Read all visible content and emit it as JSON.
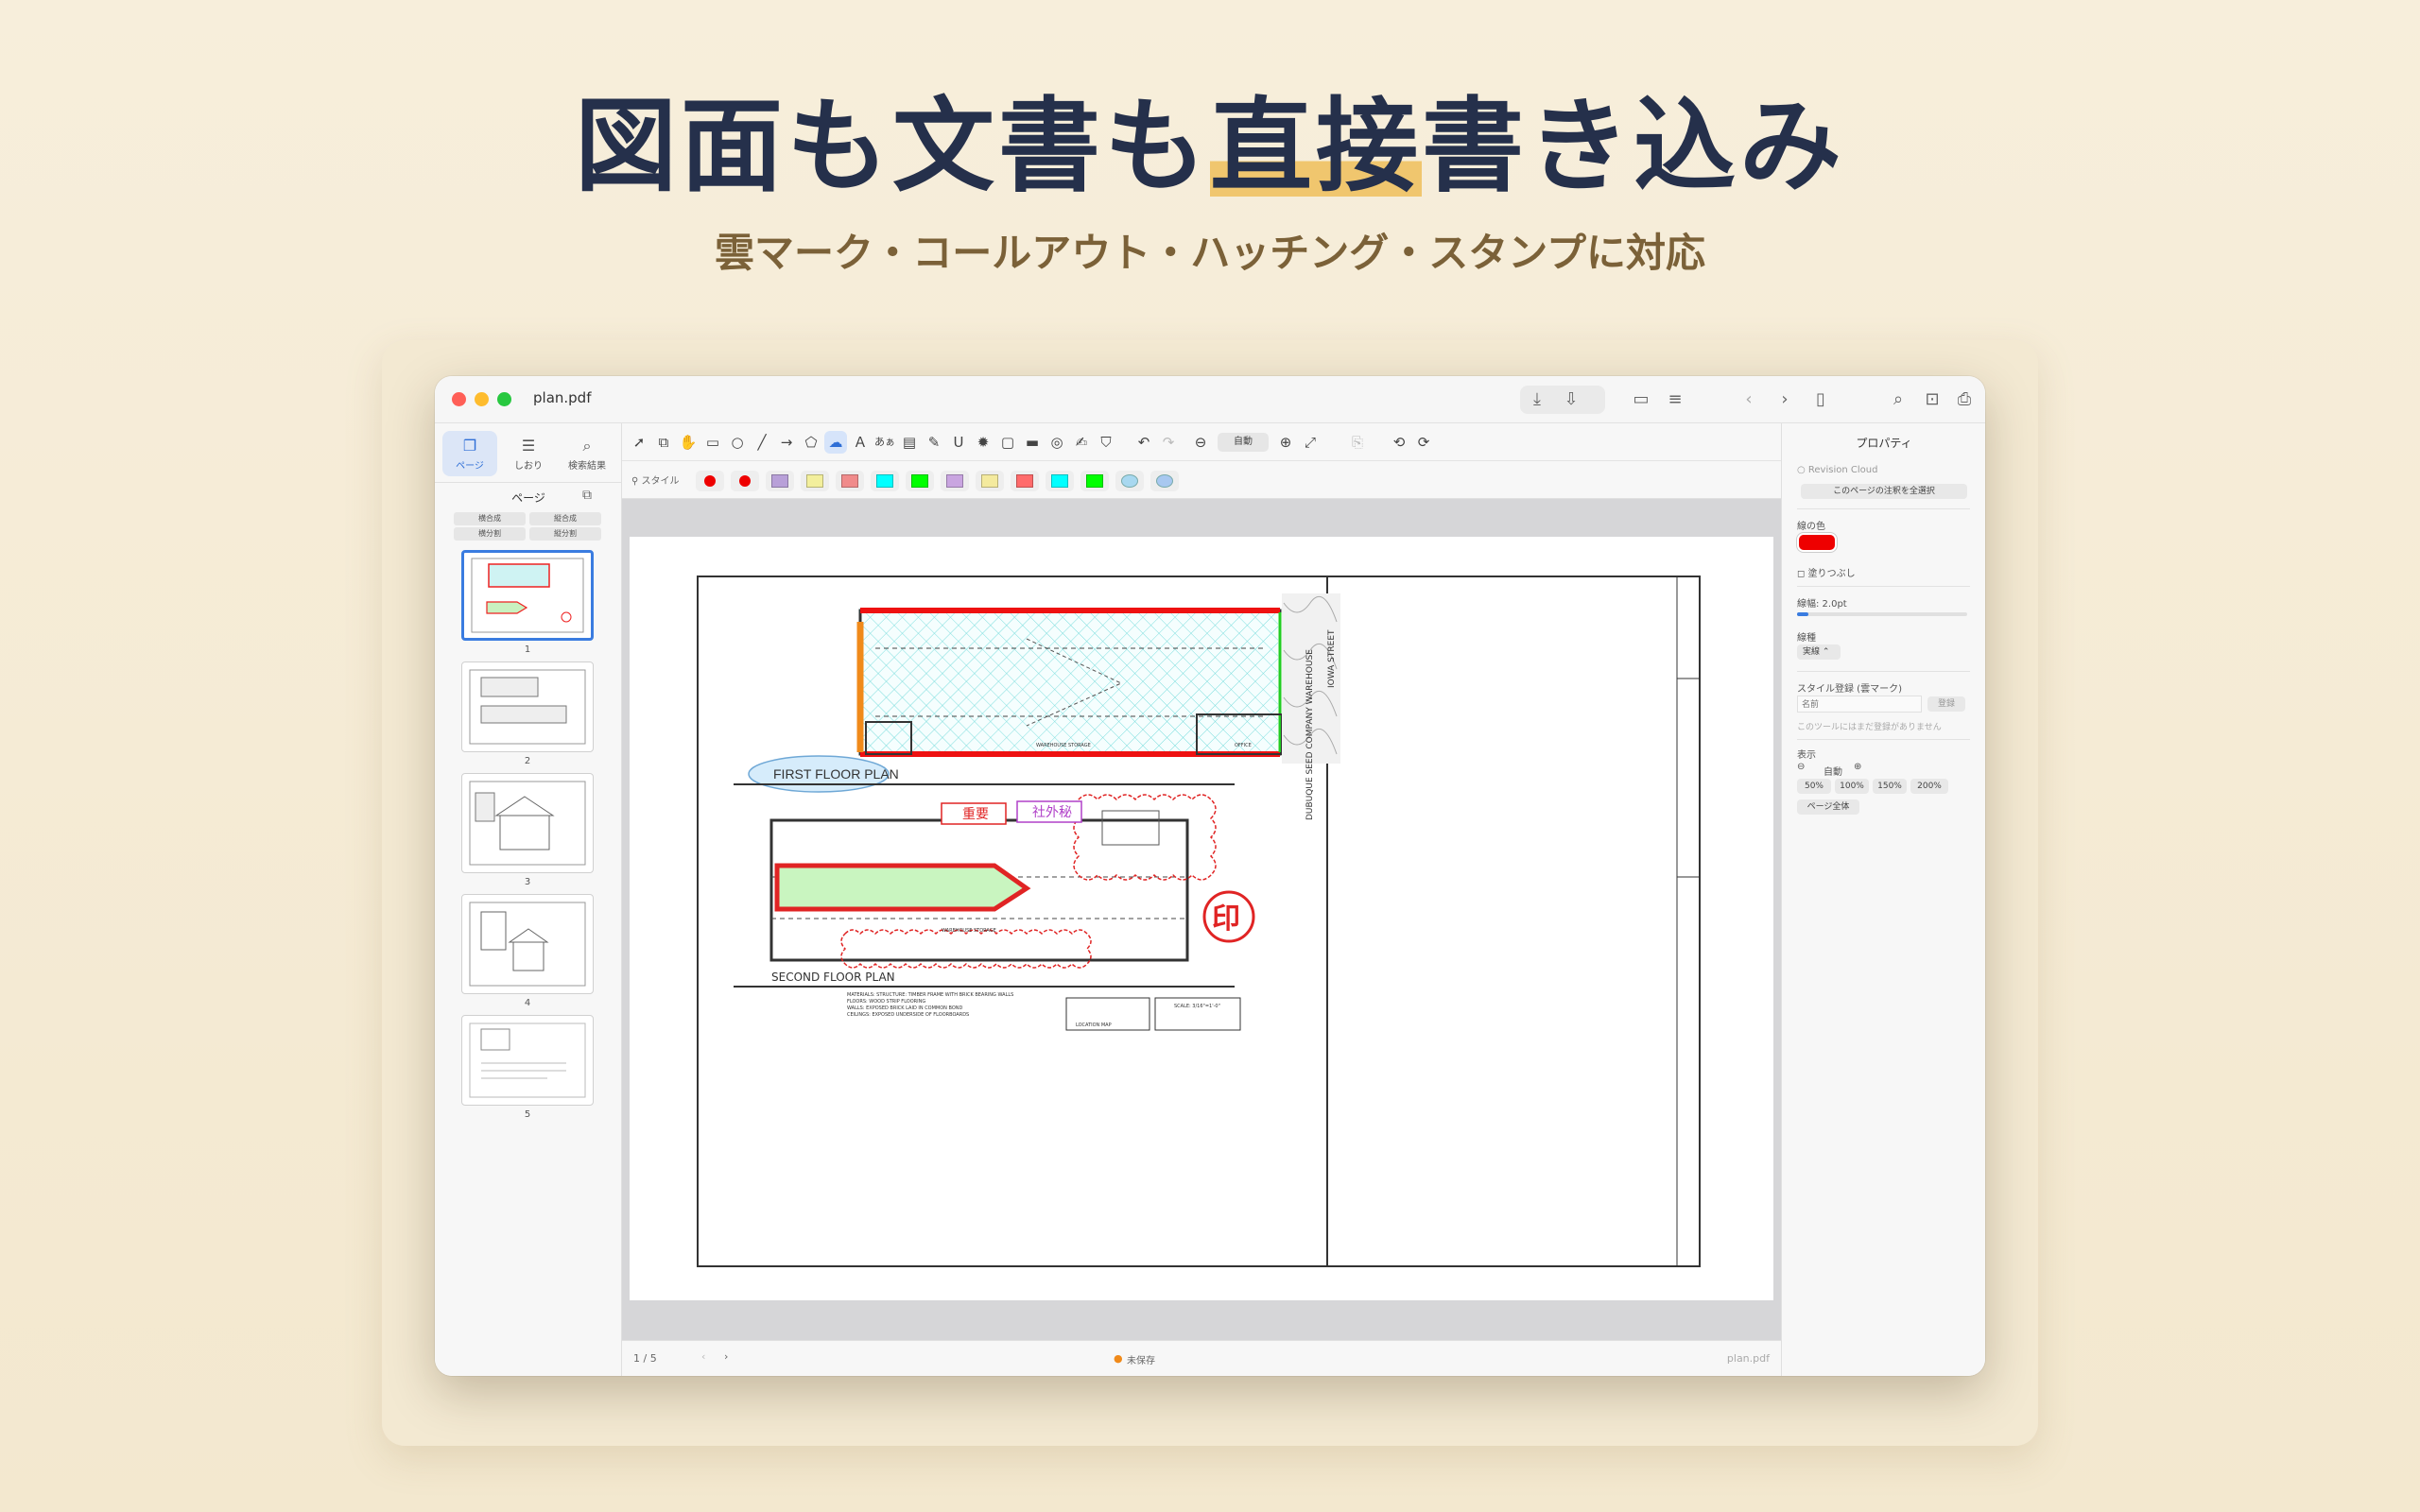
{
  "headline": {
    "part1": "図面も文書も",
    "highlight": "直接",
    "part2": "書き込み"
  },
  "subline": "雲マーク・コールアウト・ハッチング・スタンプに対応",
  "window": {
    "title": "plan.pdf"
  },
  "sidebar": {
    "tabs": [
      {
        "label": "ページ",
        "icon": "pages-icon"
      },
      {
        "label": "しおり",
        "icon": "bookmark-icon"
      },
      {
        "label": "検索結果",
        "icon": "search-icon"
      }
    ],
    "pages_label": "ページ",
    "buttons": [
      "横合成",
      "縦合成",
      "横分割",
      "縦分割"
    ],
    "thumbnails": [
      "1",
      "2",
      "3",
      "4",
      "5"
    ]
  },
  "toolbar": {
    "style_label": "スタイル",
    "kana_tool": "あぁ",
    "zoom_label": "自動"
  },
  "swatch_colors": [
    "#ee0000",
    "#ee0000",
    "#b8a0d8",
    "#f3ef9c",
    "#f08b8b",
    "#00ffff",
    "#00ff00",
    "#c9a5e0",
    "#f4ea9e",
    "#ff6b6b",
    "#00ffff",
    "#00ff00",
    "#a8d8f0",
    "#a8c8f0"
  ],
  "drawing": {
    "first_floor_label": "FIRST FLOOR PLAN",
    "second_floor_label": "SECOND FLOOR PLAN",
    "stamp_important": "重要",
    "stamp_confidential": "社外秘",
    "seal": "印",
    "street_label": "IOWA STREET",
    "title_block": "DUBUQUE SEED COMPANY WAREHOUSE",
    "scale": "SCALE: 3/16\"=1'-0\"",
    "warehouse_storage": "WAREHOUSE STORAGE",
    "office": "OFFICE",
    "location_map": "LOCATION MAP",
    "notes": [
      "MATERIALS: STRUCTURE: TIMBER FRAME WITH BRICK BEARING WALLS",
      "FLOORS: WOOD STRIP FLOORING",
      "WALLS: EXPOSED BRICK LAID IN COMMON BOND",
      "CEILINGS: EXPOSED UNDERSIDE OF FLOORBOARDS"
    ]
  },
  "status": {
    "page": "1 / 5",
    "unsaved": "未保存",
    "filename": "plan.pdf"
  },
  "properties": {
    "title": "プロパティ",
    "annotation_type": "Revision Cloud",
    "select_all": "このページの注釈を全選択",
    "line_color_label": "線の色",
    "line_color": "#ee0000",
    "fill_label": "塗りつぶし",
    "line_width_label": "線幅: 2.0pt",
    "line_width": 2.0,
    "line_style_label": "線種",
    "line_style": "実線",
    "style_register_label": "スタイル登録 (雲マーク)",
    "name_placeholder": "名前",
    "register_button": "登録",
    "no_styles": "このツールにはまだ登録がありません",
    "display_label": "表示",
    "zoom_auto": "自動",
    "zoom_options": [
      "50%",
      "100%",
      "150%",
      "200%"
    ],
    "fit_page": "ページ全体"
  }
}
